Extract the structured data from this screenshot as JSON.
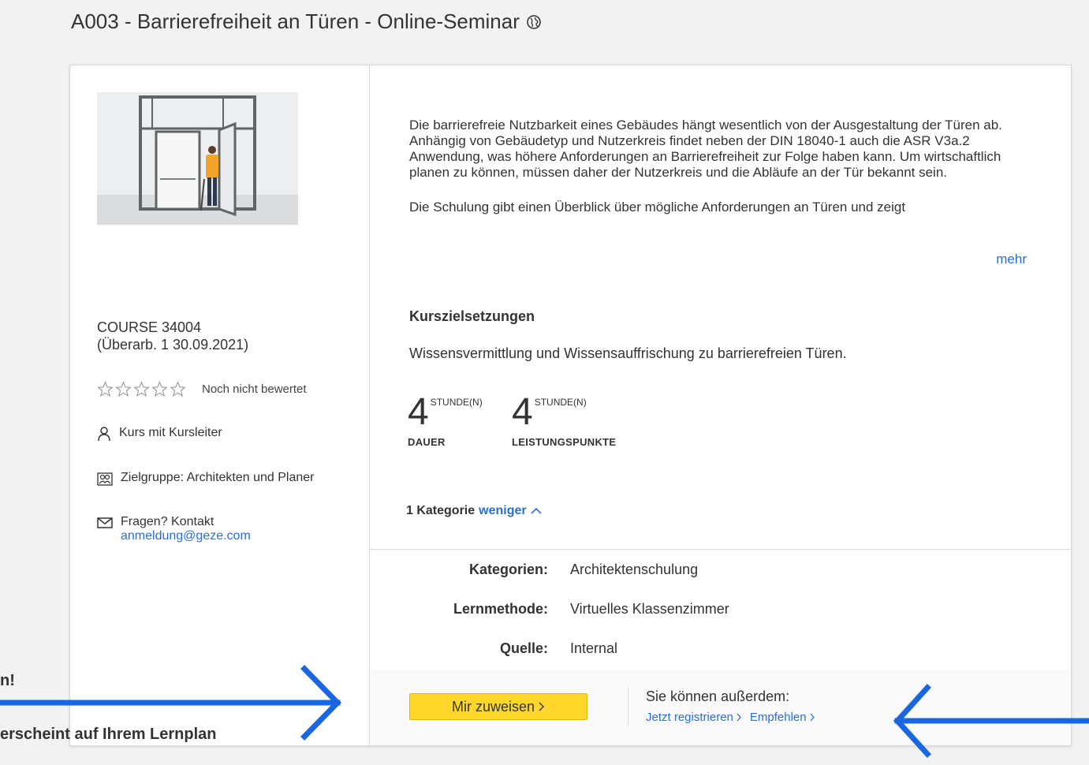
{
  "header": {
    "title": "A003 - Barrierefreiheit an Türen - Online-Seminar",
    "globe_icon": "globe-icon"
  },
  "sidebar": {
    "course_id": "COURSE 34004",
    "revision": "(Überarb. 1 30.09.2021)",
    "rating_text": "Noch nicht bewertet",
    "instructor": "Kurs mit Kursleiter",
    "audience": "Zielgruppe: Architekten und Planer",
    "contact_label": "Fragen? Kontakt",
    "contact_email": "anmeldung@geze.com"
  },
  "main": {
    "description_p1": "Die barrierefreie Nutzbarkeit eines Gebäudes hängt wesentlich von der Ausgestaltung der Türen ab. Anhängig von Gebäudetyp und Nutzerkreis findet neben der DIN 18040-1 auch die ASR V3a.2 Anwendung, was höhere Anforderungen an Barrierefreiheit zur Folge haben kann. Um wirtschaftlich planen zu können, müssen daher der Nutzerkreis und die Abläufe an der Tür bekannt sein.",
    "description_p2": "Die Schulung gibt einen Überblick über mögliche Anforderungen an Türen und zeigt",
    "more_link": "mehr",
    "goals_title": "Kurszielsetzungen",
    "goals_text": "Wissensvermittlung und Wissensauffrischung zu barrierefreien Türen.",
    "duration": {
      "value": "4",
      "unit": "STUNDE(N)",
      "label": "DAUER"
    },
    "credits": {
      "value": "4",
      "unit": "STUNDE(N)",
      "label": "LEISTUNGSPUNKTE"
    },
    "category_count": "1 Kategorie",
    "category_toggle": "weniger",
    "details": [
      {
        "key": "Kategorien:",
        "value": "Architektenschulung"
      },
      {
        "key": "Lernmethode:",
        "value": "Virtuelles Klassenzimmer"
      },
      {
        "key": "Quelle:",
        "value": "Internal"
      }
    ]
  },
  "footer": {
    "assign_button": "Mir zuweisen",
    "also_label": "Sie können außerdem:",
    "register_link": "Jetzt registrieren",
    "recommend_link": "Empfehlen"
  },
  "annotations": {
    "line1": "n!",
    "line2": "erscheint auf Ihrem Lernplan",
    "arrow_color": "#1a66e0"
  }
}
